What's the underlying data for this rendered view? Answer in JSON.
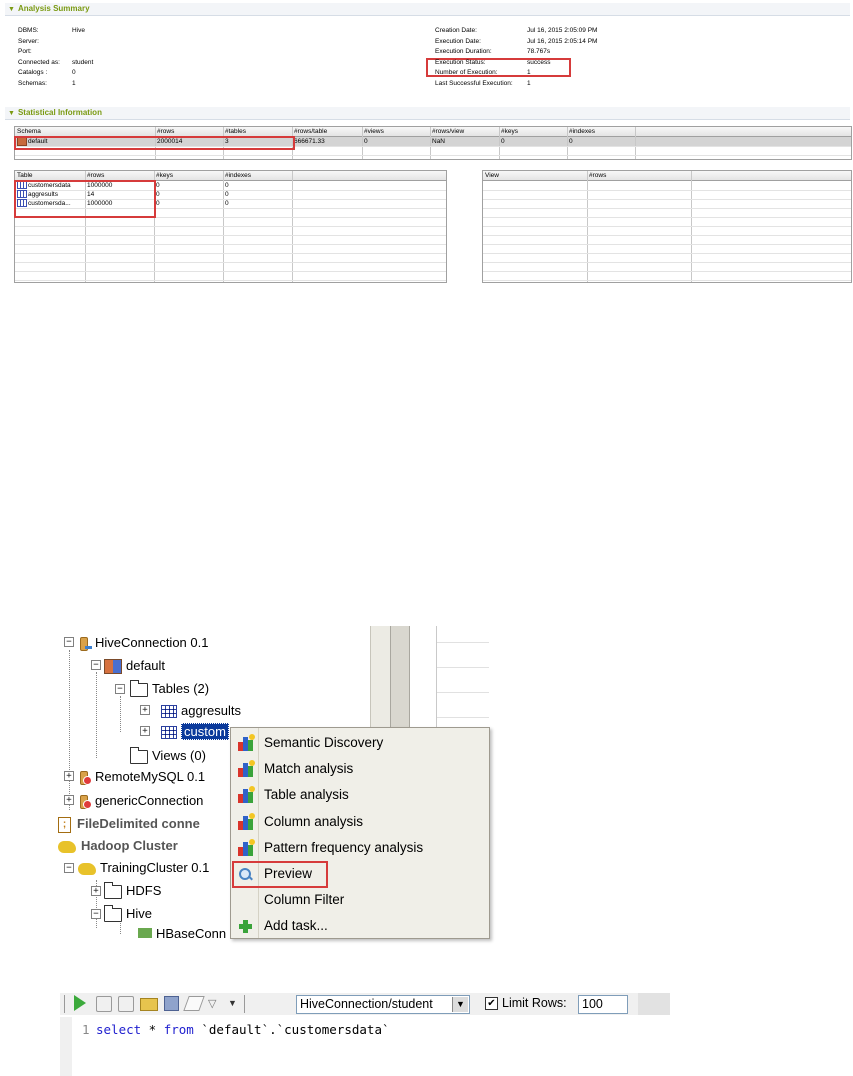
{
  "analysis_summary": {
    "title": "Analysis Summary",
    "left": [
      {
        "label": "DBMS:",
        "value": "Hive"
      },
      {
        "label": "Server:",
        "value": ""
      },
      {
        "label": "Port:",
        "value": ""
      },
      {
        "label": "Connected as:",
        "value": "student"
      },
      {
        "label": "Catalogs :",
        "value": "0"
      },
      {
        "label": "Schemas:",
        "value": "1"
      }
    ],
    "right": [
      {
        "label": "Creation Date:",
        "value": "Jul 16, 2015 2:05:09 PM"
      },
      {
        "label": "Execution Date:",
        "value": "Jul 16, 2015 2:05:14 PM"
      },
      {
        "label": "Execution Duration:",
        "value": "78.767s"
      },
      {
        "label": "Execution Status:",
        "value": "success"
      },
      {
        "label": "Number of Execution:",
        "value": "1"
      },
      {
        "label": "Last Successful Execution:",
        "value": "1"
      }
    ]
  },
  "statistical_information": {
    "title": "Statistical Information",
    "schema_table": {
      "headers": [
        "Schema",
        "#rows",
        "#tables",
        "#rows/table",
        "#views",
        "#rows/view",
        "#keys",
        "#indexes"
      ],
      "row": [
        "default",
        "2000014",
        "3",
        "666671.33",
        "0",
        "NaN",
        "0",
        "0"
      ]
    },
    "tables_table": {
      "headers": [
        "Table",
        "#rows",
        "#keys",
        "#indexes"
      ],
      "rows": [
        [
          "customersdata",
          "1000000",
          "0",
          "0"
        ],
        [
          "aggresults",
          "14",
          "0",
          "0"
        ],
        [
          "customersda...",
          "1000000",
          "0",
          "0"
        ]
      ]
    },
    "views_table": {
      "headers": [
        "View",
        "#rows"
      ]
    }
  },
  "repository_tree": {
    "hive_connection": "HiveConnection 0.1",
    "default_schema": "default",
    "tables_folder": "Tables (2)",
    "aggresults": "aggresults",
    "custom_item": "custom",
    "views_folder": "Views (0)",
    "remote_mysql": "RemoteMySQL 0.1",
    "generic_connection": "genericConnection",
    "file_delimited": "FileDelimited conne",
    "hadoop_cluster": "Hadoop Cluster",
    "training_cluster": "TrainingCluster 0.1",
    "hdfs": "HDFS",
    "hive": "Hive",
    "hbase_conn": "HBaseConn"
  },
  "context_menu": {
    "items": [
      {
        "label": "Semantic Discovery"
      },
      {
        "label": "Match analysis"
      },
      {
        "label": "Table analysis"
      },
      {
        "label": "Column analysis"
      },
      {
        "label": "Pattern frequency analysis"
      },
      {
        "label": "Preview"
      },
      {
        "label": "Column Filter"
      },
      {
        "label": "Add task..."
      }
    ]
  },
  "sql_editor": {
    "connection": "HiveConnection/student",
    "limit_rows_label": "Limit Rows:",
    "limit_rows_checked": true,
    "limit_rows_value": "100",
    "line_number": "1",
    "kw_select": "select",
    "star": " * ",
    "kw_from": "from",
    "table_ref": " `default`.`customersdata`"
  },
  "colors": {
    "highlight_red": "#d63b3b",
    "section_green": "#7a9a12",
    "keyword_blue": "#1f1fcf"
  }
}
